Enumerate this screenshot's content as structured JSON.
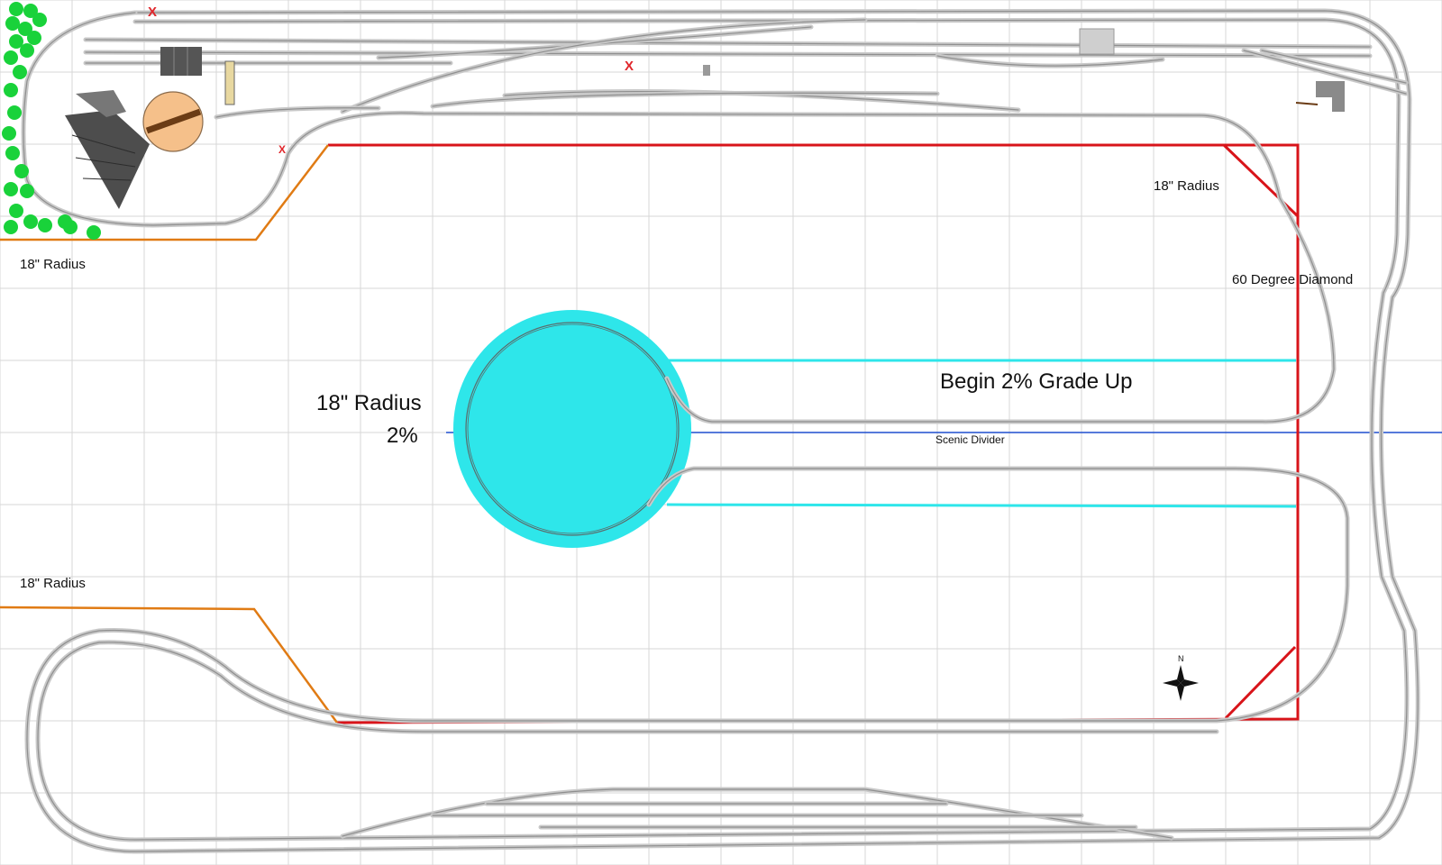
{
  "labels": {
    "radius_top_left": "18\" Radius",
    "radius_top_right": "18\" Radius",
    "diamond": "60 Degree Diamond",
    "helix_radius": "18\" Radius",
    "helix_grade": "2%",
    "grade_start": "Begin 2% Grade Up",
    "scenic_divider": "Scenic Divider",
    "radius_bottom_left": "18\" Radius",
    "compass_north": "N"
  },
  "markers": {
    "removed_track": "X"
  },
  "colors": {
    "background": "#ffffff",
    "grid": "#d7d7d7",
    "track_rail": "#8f8f8f",
    "track_bed": "#c9c9c9",
    "benchwork_outline": "#d8141a",
    "benchwork_edge": "#e07b14",
    "helix": "#2ee6ea",
    "scenic_divider": "#1f4fcf",
    "trees": "#19d23a",
    "turntable": "#f5c08a",
    "roundhouse": "#4d4d4d",
    "removed_marker": "#e0262b"
  },
  "structures": {
    "roundhouse": "roundhouse",
    "turntable": "turntable",
    "helix": "helix",
    "compass": "compass-rose",
    "trees": "tree-cluster"
  }
}
